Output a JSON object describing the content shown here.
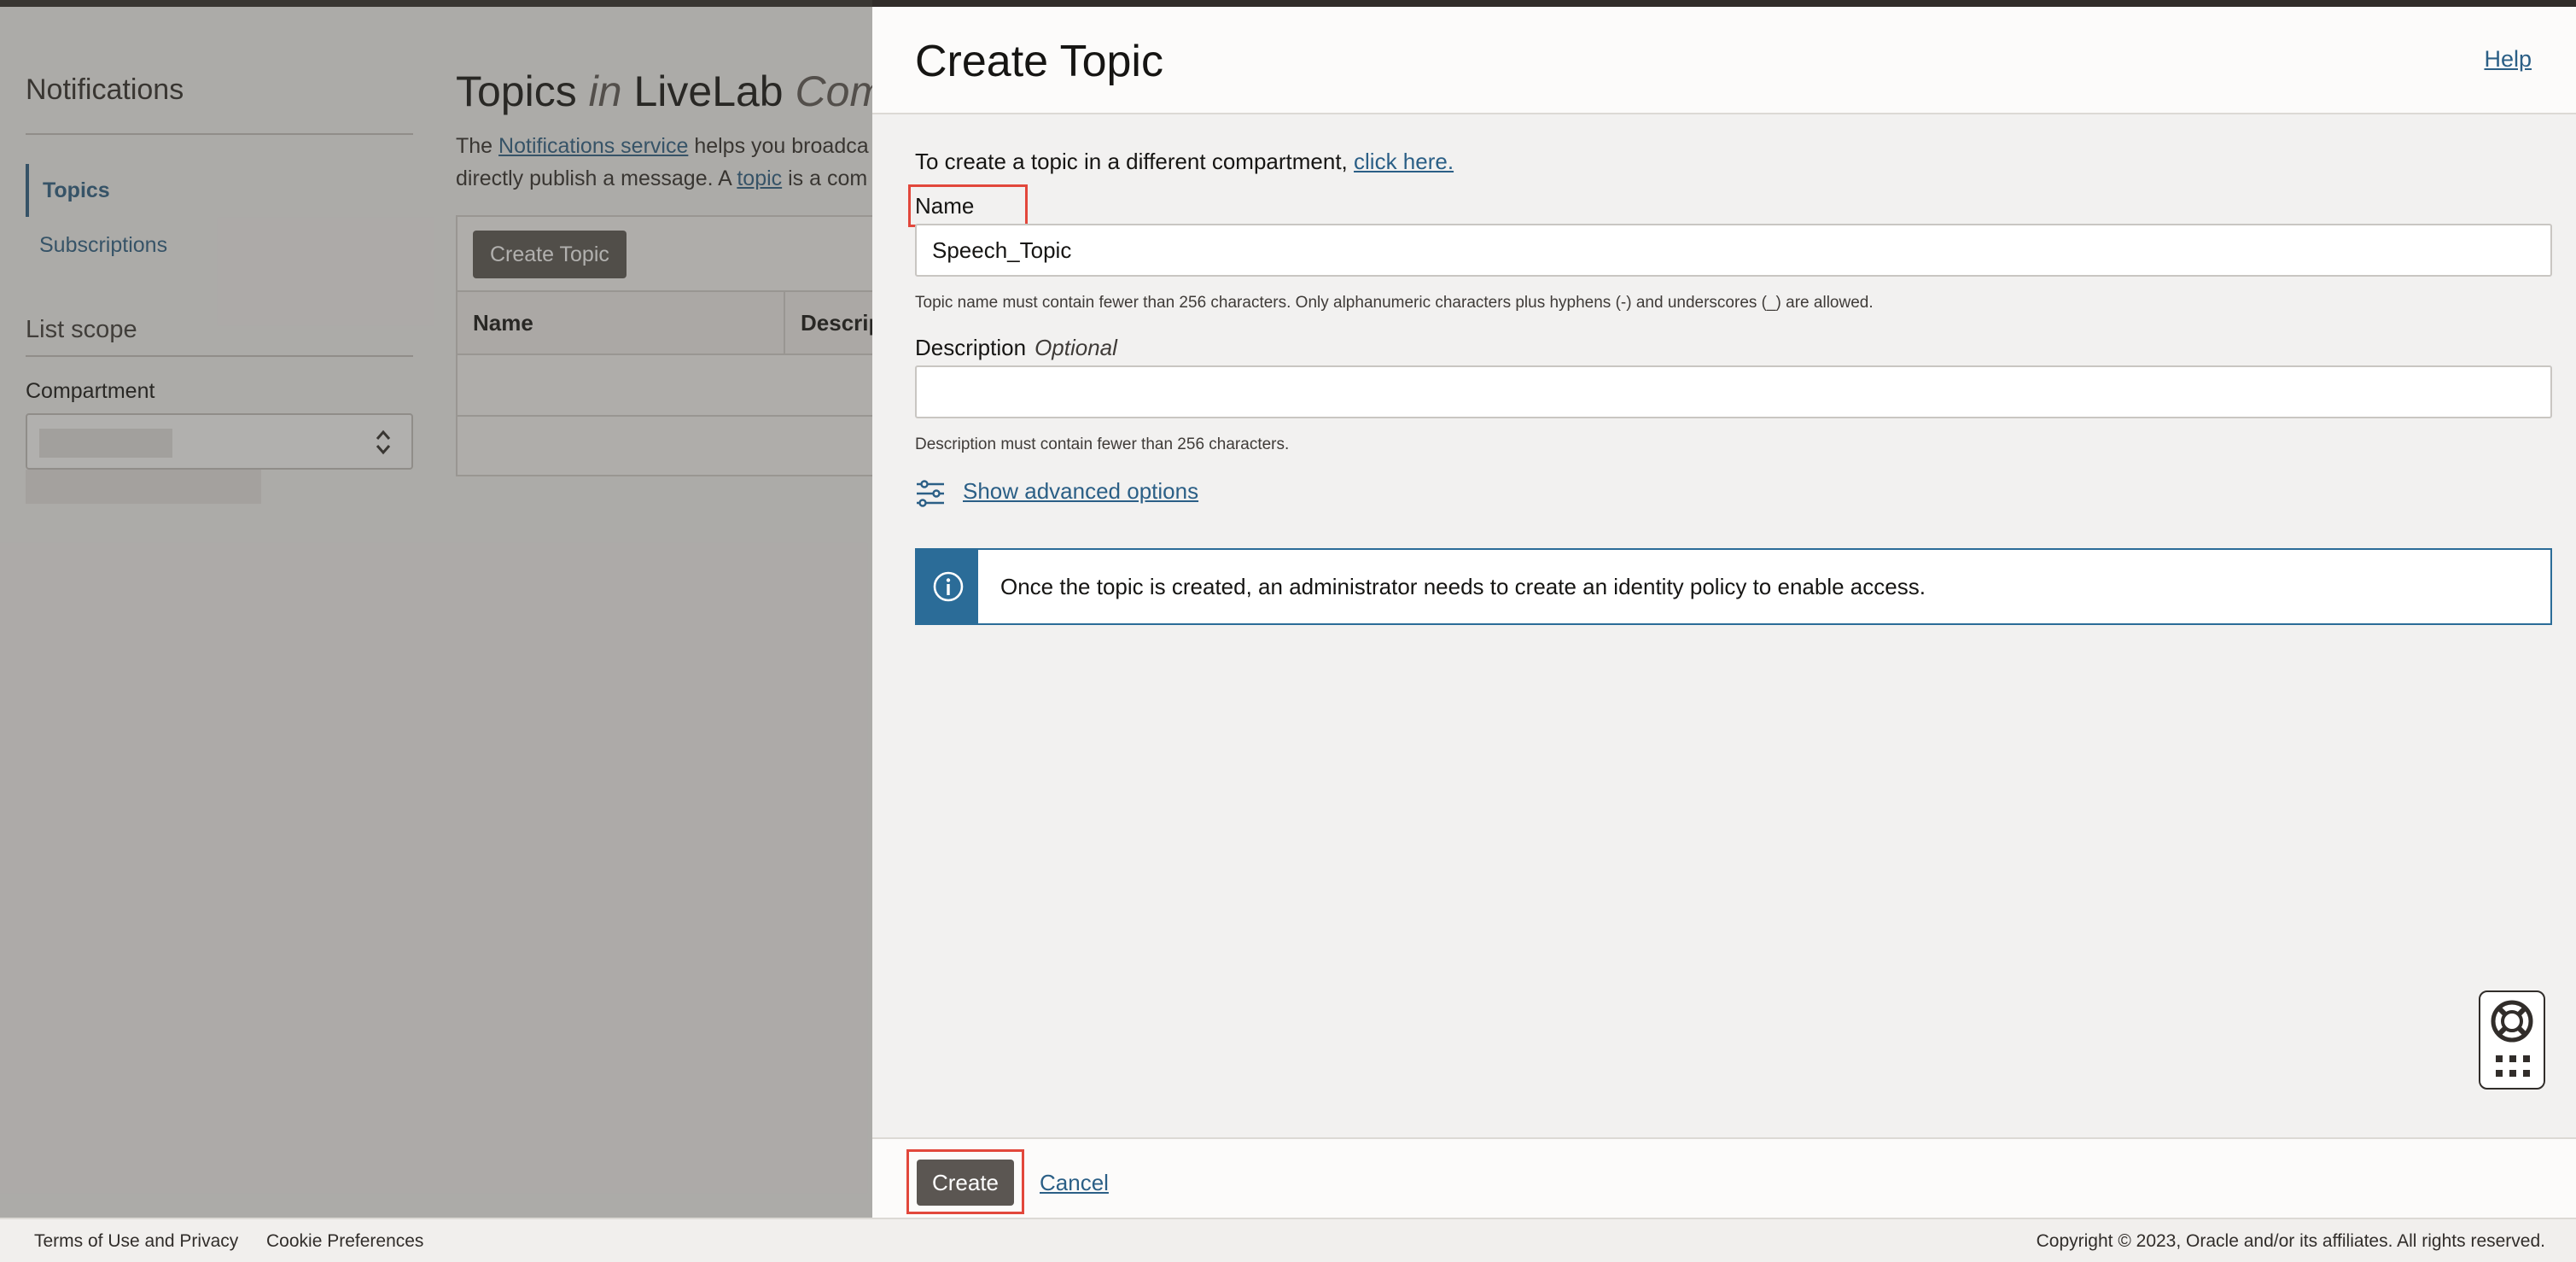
{
  "background": {
    "nav": {
      "title": "Notifications",
      "items": [
        {
          "label": "Topics",
          "active": true
        },
        {
          "label": "Subscriptions",
          "active": false
        }
      ],
      "scope_title": "List scope",
      "compartment_label": "Compartment"
    },
    "main": {
      "title_prefix": "Topics",
      "title_in": "in",
      "title_suffix": "LiveLab",
      "title_cut": "Com",
      "desc_line1_a": "The",
      "desc_line1_link": "Notifications service",
      "desc_line1_b": "helps you broadca",
      "desc_line2_a": "directly publish a message. A",
      "desc_line2_link": "topic",
      "desc_line2_b": "is a com",
      "create_topic_label": "Create Topic",
      "col_name": "Name",
      "col_desc": "Descrip"
    }
  },
  "panel": {
    "title": "Create Topic",
    "help_label": "Help",
    "diff_compartment_text": "To create a topic in a different compartment,",
    "diff_compartment_link": "click here.",
    "name_label": "Name",
    "name_value": "Speech_Topic",
    "name_hint": "Topic name must contain fewer than 256 characters. Only alphanumeric characters plus hyphens (-) and underscores (_) are allowed.",
    "desc_label": "Description",
    "desc_optional": "Optional",
    "desc_value": "",
    "desc_hint": "Description must contain fewer than 256 characters.",
    "advanced_label": "Show advanced options",
    "info_text": "Once the topic is created, an administrator needs to create an identity policy to enable access.",
    "create_label": "Create",
    "cancel_label": "Cancel"
  },
  "footer": {
    "terms": "Terms of Use and Privacy",
    "cookies": "Cookie Preferences",
    "copyright": "Copyright © 2023, Oracle and/or its affiliates. All rights reserved."
  },
  "colors": {
    "accent": "#2b5f86",
    "highlight": "#e2473b",
    "button_dark": "#5b5652",
    "info_blue": "#2b6c98"
  }
}
